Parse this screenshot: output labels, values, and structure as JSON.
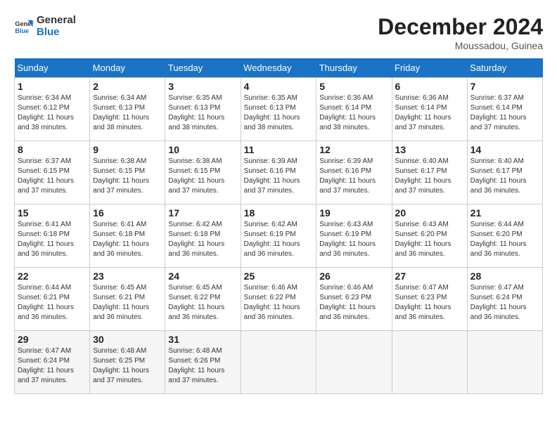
{
  "logo": {
    "line1": "General",
    "line2": "Blue"
  },
  "title": "December 2024",
  "subtitle": "Moussadou, Guinea",
  "days_of_week": [
    "Sunday",
    "Monday",
    "Tuesday",
    "Wednesday",
    "Thursday",
    "Friday",
    "Saturday"
  ],
  "weeks": [
    [
      {
        "day": "1",
        "detail": "Sunrise: 6:34 AM\nSunset: 6:12 PM\nDaylight: 11 hours\nand 38 minutes."
      },
      {
        "day": "2",
        "detail": "Sunrise: 6:34 AM\nSunset: 6:13 PM\nDaylight: 11 hours\nand 38 minutes."
      },
      {
        "day": "3",
        "detail": "Sunrise: 6:35 AM\nSunset: 6:13 PM\nDaylight: 11 hours\nand 38 minutes."
      },
      {
        "day": "4",
        "detail": "Sunrise: 6:35 AM\nSunset: 6:13 PM\nDaylight: 11 hours\nand 38 minutes."
      },
      {
        "day": "5",
        "detail": "Sunrise: 6:36 AM\nSunset: 6:14 PM\nDaylight: 11 hours\nand 38 minutes."
      },
      {
        "day": "6",
        "detail": "Sunrise: 6:36 AM\nSunset: 6:14 PM\nDaylight: 11 hours\nand 37 minutes."
      },
      {
        "day": "7",
        "detail": "Sunrise: 6:37 AM\nSunset: 6:14 PM\nDaylight: 11 hours\nand 37 minutes."
      }
    ],
    [
      {
        "day": "8",
        "detail": "Sunrise: 6:37 AM\nSunset: 6:15 PM\nDaylight: 11 hours\nand 37 minutes."
      },
      {
        "day": "9",
        "detail": "Sunrise: 6:38 AM\nSunset: 6:15 PM\nDaylight: 11 hours\nand 37 minutes."
      },
      {
        "day": "10",
        "detail": "Sunrise: 6:38 AM\nSunset: 6:15 PM\nDaylight: 11 hours\nand 37 minutes."
      },
      {
        "day": "11",
        "detail": "Sunrise: 6:39 AM\nSunset: 6:16 PM\nDaylight: 11 hours\nand 37 minutes."
      },
      {
        "day": "12",
        "detail": "Sunrise: 6:39 AM\nSunset: 6:16 PM\nDaylight: 11 hours\nand 37 minutes."
      },
      {
        "day": "13",
        "detail": "Sunrise: 6:40 AM\nSunset: 6:17 PM\nDaylight: 11 hours\nand 37 minutes."
      },
      {
        "day": "14",
        "detail": "Sunrise: 6:40 AM\nSunset: 6:17 PM\nDaylight: 11 hours\nand 36 minutes."
      }
    ],
    [
      {
        "day": "15",
        "detail": "Sunrise: 6:41 AM\nSunset: 6:18 PM\nDaylight: 11 hours\nand 36 minutes."
      },
      {
        "day": "16",
        "detail": "Sunrise: 6:41 AM\nSunset: 6:18 PM\nDaylight: 11 hours\nand 36 minutes."
      },
      {
        "day": "17",
        "detail": "Sunrise: 6:42 AM\nSunset: 6:18 PM\nDaylight: 11 hours\nand 36 minutes."
      },
      {
        "day": "18",
        "detail": "Sunrise: 6:42 AM\nSunset: 6:19 PM\nDaylight: 11 hours\nand 36 minutes."
      },
      {
        "day": "19",
        "detail": "Sunrise: 6:43 AM\nSunset: 6:19 PM\nDaylight: 11 hours\nand 36 minutes."
      },
      {
        "day": "20",
        "detail": "Sunrise: 6:43 AM\nSunset: 6:20 PM\nDaylight: 11 hours\nand 36 minutes."
      },
      {
        "day": "21",
        "detail": "Sunrise: 6:44 AM\nSunset: 6:20 PM\nDaylight: 11 hours\nand 36 minutes."
      }
    ],
    [
      {
        "day": "22",
        "detail": "Sunrise: 6:44 AM\nSunset: 6:21 PM\nDaylight: 11 hours\nand 36 minutes."
      },
      {
        "day": "23",
        "detail": "Sunrise: 6:45 AM\nSunset: 6:21 PM\nDaylight: 11 hours\nand 36 minutes."
      },
      {
        "day": "24",
        "detail": "Sunrise: 6:45 AM\nSunset: 6:22 PM\nDaylight: 11 hours\nand 36 minutes."
      },
      {
        "day": "25",
        "detail": "Sunrise: 6:46 AM\nSunset: 6:22 PM\nDaylight: 11 hours\nand 36 minutes."
      },
      {
        "day": "26",
        "detail": "Sunrise: 6:46 AM\nSunset: 6:23 PM\nDaylight: 11 hours\nand 36 minutes."
      },
      {
        "day": "27",
        "detail": "Sunrise: 6:47 AM\nSunset: 6:23 PM\nDaylight: 11 hours\nand 36 minutes."
      },
      {
        "day": "28",
        "detail": "Sunrise: 6:47 AM\nSunset: 6:24 PM\nDaylight: 11 hours\nand 36 minutes."
      }
    ],
    [
      {
        "day": "29",
        "detail": "Sunrise: 6:47 AM\nSunset: 6:24 PM\nDaylight: 11 hours\nand 37 minutes."
      },
      {
        "day": "30",
        "detail": "Sunrise: 6:48 AM\nSunset: 6:25 PM\nDaylight: 11 hours\nand 37 minutes."
      },
      {
        "day": "31",
        "detail": "Sunrise: 6:48 AM\nSunset: 6:26 PM\nDaylight: 11 hours\nand 37 minutes."
      },
      null,
      null,
      null,
      null
    ]
  ]
}
